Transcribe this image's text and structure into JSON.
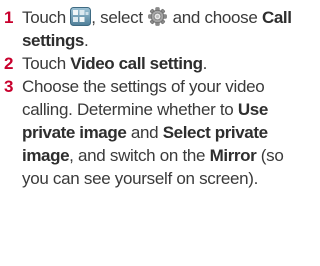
{
  "steps": [
    {
      "number": "1",
      "parts": [
        {
          "t": "text",
          "v": "Touch "
        },
        {
          "t": "icon",
          "name": "apps-menu-icon"
        },
        {
          "t": "text",
          "v": ", select "
        },
        {
          "t": "icon",
          "name": "settings-gear-icon"
        },
        {
          "t": "text",
          "v": " and choose "
        },
        {
          "t": "bold",
          "v": "Call settings"
        },
        {
          "t": "text",
          "v": "."
        }
      ]
    },
    {
      "number": "2",
      "parts": [
        {
          "t": "text",
          "v": "Touch "
        },
        {
          "t": "bold",
          "v": "Video call setting"
        },
        {
          "t": "text",
          "v": "."
        }
      ]
    },
    {
      "number": "3",
      "parts": [
        {
          "t": "text",
          "v": "Choose the settings of your video calling. Determine whether to "
        },
        {
          "t": "bold",
          "v": "Use private image"
        },
        {
          "t": "text",
          "v": " and "
        },
        {
          "t": "bold",
          "v": "Select private image"
        },
        {
          "t": "text",
          "v": ", and switch on the "
        },
        {
          "t": "bold",
          "v": "Mirror"
        },
        {
          "t": "text",
          "v": " (so you can see yourself on screen)."
        }
      ]
    }
  ],
  "colors": {
    "step_number": "#c8002d",
    "text": "#3a3a3a"
  }
}
